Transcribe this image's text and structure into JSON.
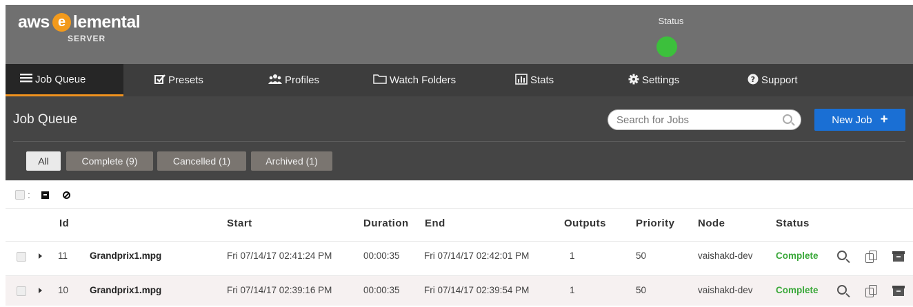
{
  "header": {
    "logo_prefix": "aws",
    "logo_e": "e",
    "logo_main": "lemental",
    "logo_sub": "SERVER",
    "status_label": "Status",
    "status_color": "#3cc03c"
  },
  "nav": {
    "items": [
      {
        "label": "Job Queue",
        "icon": "list-icon",
        "active": true
      },
      {
        "label": "Presets",
        "icon": "checkbox-icon",
        "active": false
      },
      {
        "label": "Profiles",
        "icon": "users-icon",
        "active": false
      },
      {
        "label": "Watch Folders",
        "icon": "folder-icon",
        "active": false
      },
      {
        "label": "Stats",
        "icon": "bar-chart-icon",
        "active": false
      },
      {
        "label": "Settings",
        "icon": "gear-icon",
        "active": false
      },
      {
        "label": "Support",
        "icon": "help-icon",
        "active": false
      }
    ]
  },
  "toolbar": {
    "title": "Job Queue",
    "search_placeholder": "Search for Jobs",
    "new_job_label": "New Job",
    "new_job_plus": "+",
    "accent": "#1a6fd4"
  },
  "filters": [
    {
      "label": "All",
      "active": true
    },
    {
      "label": "Complete (9)",
      "active": false
    },
    {
      "label": "Cancelled (1)",
      "active": false
    },
    {
      "label": "Archived (1)",
      "active": false
    }
  ],
  "bulk": {
    "colon": ":"
  },
  "table": {
    "columns": [
      "Id",
      "Start",
      "Duration",
      "End",
      "Outputs",
      "Priority",
      "Node",
      "Status"
    ],
    "rows": [
      {
        "id": "11",
        "name": "Grandprix1.mpg",
        "start": "Fri 07/14/17 02:41:24 PM",
        "duration": "00:00:35",
        "end": "Fri 07/14/17 02:42:01 PM",
        "outputs": "1",
        "priority": "50",
        "node": "vaishakd-dev",
        "status": "Complete"
      },
      {
        "id": "10",
        "name": "Grandprix1.mpg",
        "start": "Fri 07/14/17 02:39:16 PM",
        "duration": "00:00:35",
        "end": "Fri 07/14/17 02:39:54 PM",
        "outputs": "1",
        "priority": "50",
        "node": "vaishakd-dev",
        "status": "Complete"
      }
    ]
  }
}
